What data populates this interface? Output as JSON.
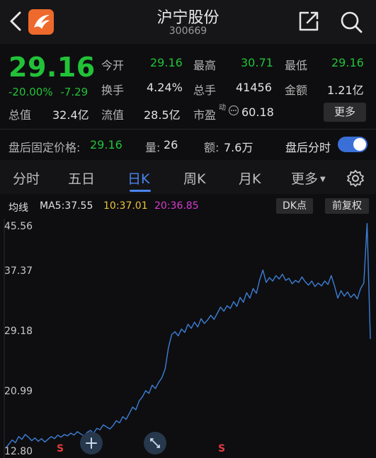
{
  "header": {
    "back_icon": "chevron-left-icon",
    "logo_icon": "app-logo-icon",
    "title": "沪宁股份",
    "code": "300669",
    "share_icon": "share-icon",
    "search_icon": "search-icon"
  },
  "quote": {
    "price": "29.16",
    "change_pct": "-20.00%",
    "change_amt": "-7.29",
    "open_label": "今开",
    "open": "29.16",
    "high_label": "最高",
    "high": "30.71",
    "low_label": "最低",
    "low": "29.16",
    "turnover_label": "换手",
    "turnover": "4.24%",
    "volume_label": "总手",
    "volume": "41456",
    "amount_label": "金额",
    "amount": "1.21亿",
    "mcap_label": "总值",
    "mcap": "32.4亿",
    "float_label": "流值",
    "float_cap": "28.5亿",
    "pe_label": "市盈",
    "pe_superscript": "动",
    "pe": "60.18",
    "more_label": "更多",
    "up_color": "#e23b3b",
    "down_color": "#22c238"
  },
  "after_hours": {
    "price_label": "盘后固定价格:",
    "price": "29.16",
    "vol_label": "量:",
    "vol": "26",
    "amt_label": "额:",
    "amt": "7.6万",
    "toggle_label": "盘后分时",
    "toggle_on": true,
    "accent": "#3a6fd8"
  },
  "tabs": {
    "items": [
      "分时",
      "五日",
      "日K",
      "周K",
      "月K",
      "更多"
    ],
    "active_index": 2,
    "settings_icon": "gear-icon"
  },
  "chart_header": {
    "label": "均线",
    "ma5": "MA5:37.55",
    "ma10": "10:37.01",
    "ma20": "20:36.85",
    "ma10_color": "#e8c23c",
    "ma20_color": "#d63ad0",
    "dk_label": "DK点",
    "adjust_label": "前复权"
  },
  "chart_data": {
    "type": "line",
    "title": "",
    "xlabel": "",
    "ylabel": "",
    "y_ticks": [
      "45.56",
      "37.37",
      "29.18",
      "20.99",
      "12.80"
    ],
    "ylim": [
      12.8,
      45.56
    ],
    "grid": false,
    "series": [
      {
        "color": "#3d7fd6",
        "values": [
          13.2,
          13.8,
          14.4,
          14.0,
          14.9,
          14.5,
          15.2,
          14.8,
          14.3,
          14.7,
          14.2,
          14.6,
          14.1,
          14.5,
          14.9,
          14.6,
          15.1,
          14.8,
          15.2,
          15.0,
          15.4,
          15.1,
          15.6,
          15.3,
          15.0,
          15.5,
          15.8,
          15.4,
          16.1,
          15.9,
          16.6,
          16.3,
          16.0,
          16.5,
          17.2,
          16.9,
          17.8,
          17.4,
          18.3,
          19.2,
          18.8,
          20.1,
          20.7,
          21.6,
          21.2,
          22.4,
          21.9,
          22.8,
          23.5,
          24.8,
          27.9,
          29.8,
          30.2,
          29.6,
          30.6,
          30.1,
          31.3,
          30.7,
          31.6,
          30.9,
          32.1,
          31.4,
          31.9,
          32.6,
          32.0,
          32.9,
          33.8,
          33.2,
          34.0,
          33.6,
          34.6,
          33.9,
          35.2,
          34.5,
          35.9,
          35.1,
          36.5,
          35.8,
          37.8,
          39.2,
          37.4,
          38.1,
          37.6,
          38.4,
          37.9,
          38.6,
          37.7,
          38.0,
          37.2,
          37.7,
          37.4,
          38.2,
          37.5,
          37.0,
          37.6,
          36.8,
          37.3,
          36.9,
          37.6,
          37.1,
          38.4,
          36.9,
          35.1,
          36.2,
          35.4,
          36.0,
          35.2,
          35.7,
          35.0,
          36.5,
          37.3,
          46.0,
          29.16
        ]
      }
    ],
    "markers": [
      {
        "text": "S",
        "color": "#e23b3b"
      },
      {
        "text": "S",
        "color": "#e23b3b"
      }
    ],
    "zoom_in_icon": "plus-icon",
    "expand_icon": "expand-icon"
  }
}
